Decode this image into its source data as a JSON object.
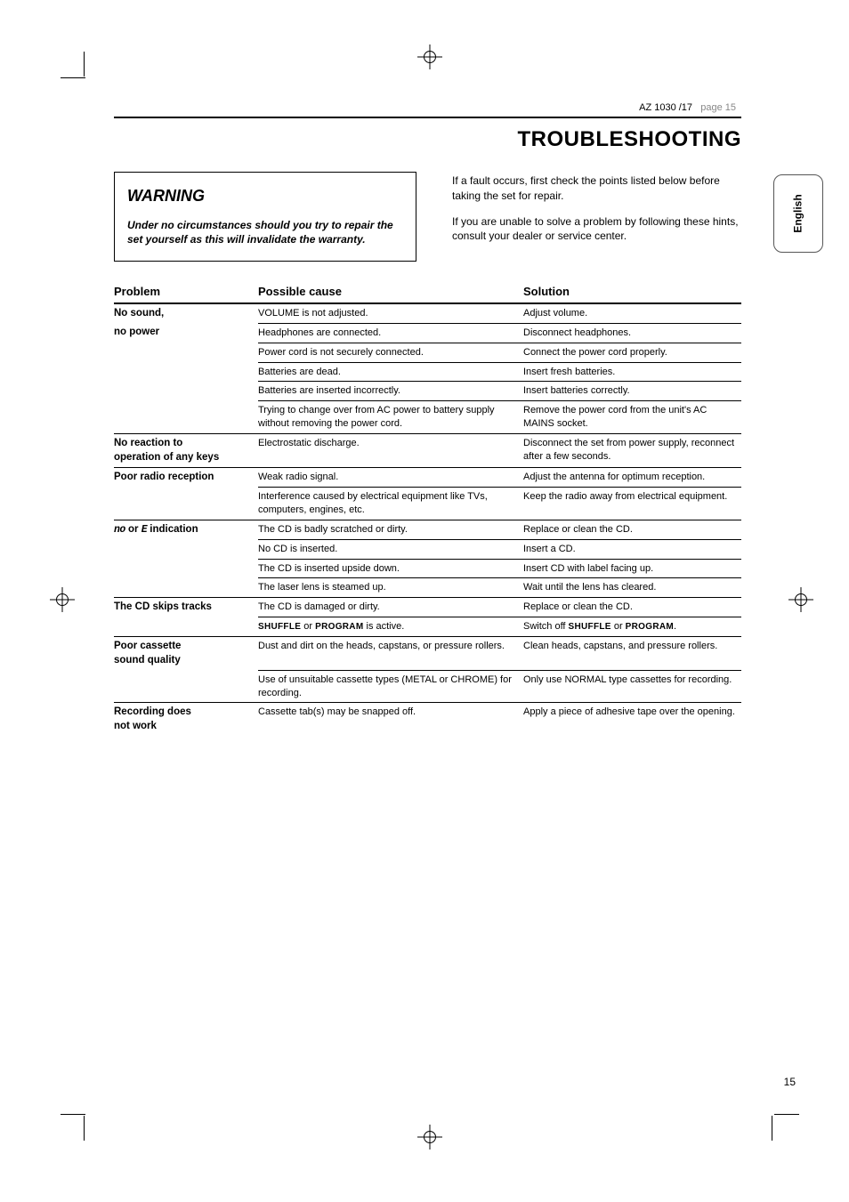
{
  "header": {
    "model": "AZ 1030 /17",
    "meta": "page 15"
  },
  "section_title": "TROUBLESHOOTING",
  "side_tab": "English",
  "warning": {
    "title": "WARNING",
    "sub": "Under no circumstances should you try to repair the set yourself as this will invalidate the warranty."
  },
  "intro": {
    "p1": "If a fault occurs, first check the points listed below before taking the set for repair.",
    "p2": "If you are unable to solve a problem by following these hints, consult your dealer or service center."
  },
  "table_headers": {
    "problem": "Problem",
    "cause": "Possible cause",
    "solution": "Solution"
  },
  "rows": [
    {
      "problem": "No sound,",
      "cause": "VOLUME is not adjusted.",
      "solution": "Adjust volume."
    },
    {
      "problem": "no power",
      "cause": "Headphones are connected.",
      "solution": "Disconnect headphones."
    },
    {
      "problem": "",
      "cause": "Power cord is not securely connected.",
      "solution": "Connect the power cord properly."
    },
    {
      "problem": "",
      "cause": "Batteries are dead.",
      "solution": "Insert fresh batteries."
    },
    {
      "problem": "",
      "cause": "Batteries are inserted incorrectly.",
      "solution": "Insert batteries correctly."
    },
    {
      "problem": "",
      "cause": "Trying to change over from AC power to battery supply without removing the power cord.",
      "solution": "Remove the power cord from the unit's AC MAINS socket."
    },
    {
      "problem_a": "No reaction to",
      "problem_b": "operation of any keys",
      "cause": "Electrostatic discharge.",
      "solution": "Disconnect the set from power supply, reconnect after a few seconds."
    },
    {
      "problem": "Poor radio reception",
      "cause": "Weak radio signal.",
      "solution": "Adjust the antenna for optimum reception."
    },
    {
      "problem": "",
      "cause": "Interference caused by electrical equipment like TVs, computers, engines, etc.",
      "solution": "Keep the radio away from electrical equipment."
    },
    {
      "problem_seg_a": "no",
      "problem_join": " or ",
      "problem_seg_b": "E",
      "problem_suffix": " indication",
      "cause": "The CD is badly scratched or dirty.",
      "solution": "Replace or clean the CD."
    },
    {
      "problem": "",
      "cause": "No CD is inserted.",
      "solution": "Insert a CD."
    },
    {
      "problem": "",
      "cause": "The CD is inserted upside down.",
      "solution": "Insert CD with label facing up."
    },
    {
      "problem": "",
      "cause": "The laser lens is steamed up.",
      "solution": "Wait until the lens has cleared."
    },
    {
      "problem": "The CD skips tracks",
      "cause": "The CD is damaged or dirty.",
      "solution": "Replace or clean the CD."
    },
    {
      "problem": "",
      "cause_a": "SHUFFLE",
      "cause_mid": " or ",
      "cause_b": "PROGRAM",
      "cause_suffix": " is active.",
      "sol_prefix": "Switch off ",
      "sol_a": "SHUFFLE",
      "sol_mid": " or ",
      "sol_b": "PROGRAM",
      "sol_suffix": "."
    },
    {
      "problem_a": "Poor cassette",
      "problem_b": "sound quality",
      "cause": "Dust and dirt on the heads, capstans, or pressure rollers.",
      "solution": "Clean heads, capstans, and pressure rollers."
    },
    {
      "problem": "",
      "cause": "Use of unsuitable cassette types (METAL or CHROME) for recording.",
      "solution": "Only use NORMAL type cassettes for recording."
    },
    {
      "problem_a": "Recording does",
      "problem_b": "not work",
      "cause": "Cassette tab(s) may be snapped off.",
      "solution": "Apply a piece of adhesive tape over the opening."
    }
  ],
  "footer_num": "15"
}
